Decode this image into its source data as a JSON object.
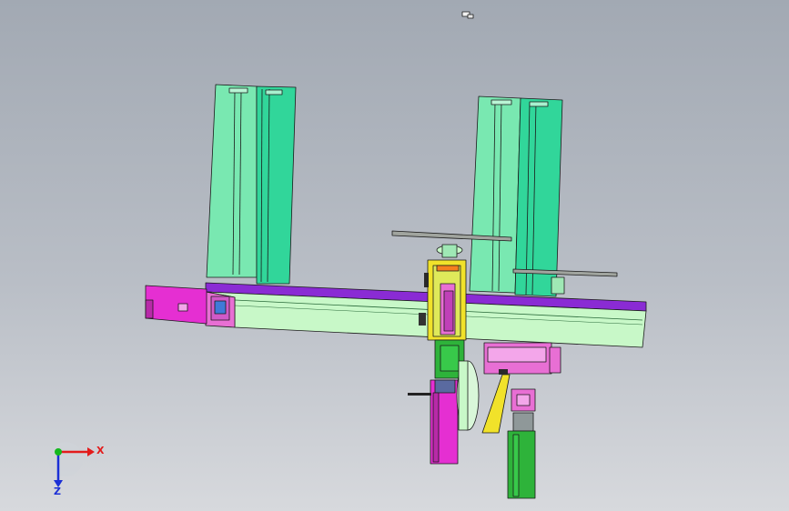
{
  "triad": {
    "x_label": "X",
    "z_label": "Z",
    "x_color": "#e31b1b",
    "z_color": "#1b2fd6",
    "y_color": "#14b81e"
  },
  "palette": {
    "frame_green": "#79e8b1",
    "frame_green_dark": "#31d69a",
    "beam_purple": "#8a2bd4",
    "beam_body": "#c8f8c8",
    "magenta": "#e52fd2",
    "pink_box": "#e86fd4",
    "yellow": "#f1e22a",
    "green_dark": "#2eb33a",
    "slider_gray": "#8f9899"
  }
}
